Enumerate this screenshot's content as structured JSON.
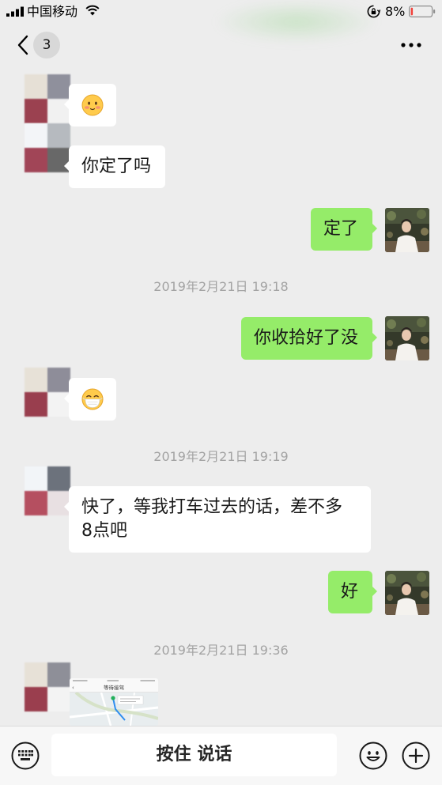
{
  "status_bar": {
    "carrier": "中国移动",
    "battery_text": "8%",
    "battery_level": 0.08,
    "icons": [
      "signal-icon",
      "wifi-icon",
      "orientation-lock-icon",
      "battery-icon"
    ]
  },
  "nav": {
    "back_icon": "chevron-left-icon",
    "unread_count": "3",
    "more_icon": "more-icon"
  },
  "messages": [
    {
      "side": "left",
      "type": "emoji",
      "emoji": "blushing-smile-emoji"
    },
    {
      "side": "left",
      "type": "text",
      "text": "你定了吗"
    },
    {
      "side": "right",
      "type": "text",
      "text": "定了"
    },
    {
      "type": "timestamp",
      "text": "2019年2月21日 19:18"
    },
    {
      "side": "right",
      "type": "text",
      "text": "你收拾好了没"
    },
    {
      "side": "left",
      "type": "emoji",
      "emoji": "mask-face-emoji"
    },
    {
      "type": "timestamp",
      "text": "2019年2月21日 19:19"
    },
    {
      "side": "left",
      "type": "text",
      "text": "快了，等我打车过去的话，差不多8点吧"
    },
    {
      "side": "right",
      "type": "text",
      "text": "好"
    },
    {
      "type": "timestamp",
      "text": "2019年2月21日 19:36"
    },
    {
      "side": "left",
      "type": "image",
      "image_title": "等待接驾"
    }
  ],
  "input_bar": {
    "voice_button_label": "按住 说话",
    "icons": [
      "keyboard-icon",
      "emoji-icon",
      "plus-icon"
    ]
  },
  "colors": {
    "background": "#ededed",
    "sent_bubble": "#95ec69",
    "received_bubble": "#ffffff",
    "timestamp_text": "#a3a3a3",
    "battery_low": "#f2423a"
  }
}
